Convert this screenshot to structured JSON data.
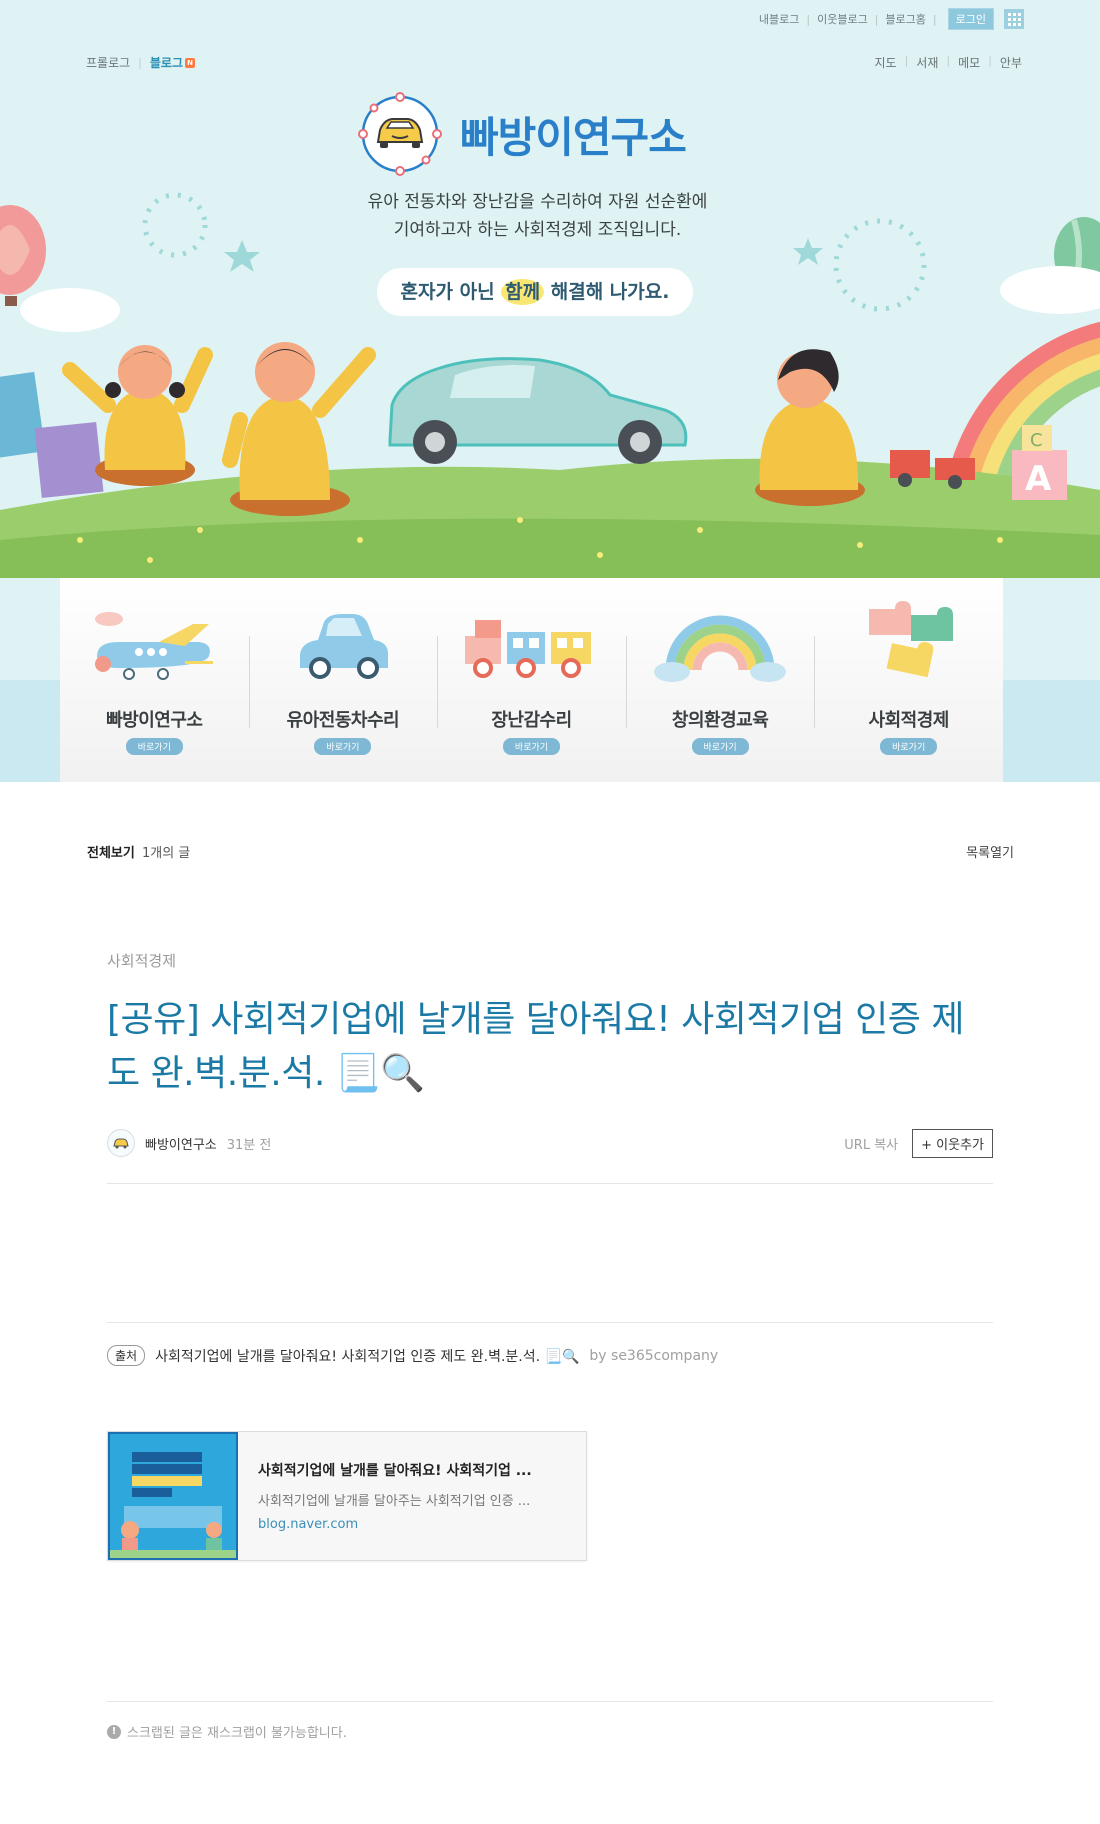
{
  "gnb": {
    "my_blog": "내블로그",
    "neighbor_blog": "이웃블로그",
    "blog_home": "블로그홈",
    "login": "로그인"
  },
  "lnb_left": {
    "prologue": "프롤로그",
    "blog": "블로그",
    "new_badge": "N"
  },
  "lnb_right": {
    "map": "지도",
    "library": "서재",
    "memo": "메모",
    "guestbook": "안부"
  },
  "header": {
    "blog_title": "빠방이연구소",
    "tagline_line1": "유아 전동차와 장난감을 수리하여 자원 선순환에",
    "tagline_line2": "기여하고자 하는 사회적경제 조직입니다.",
    "slogan_pre": "혼자가 아닌 ",
    "slogan_hl": "함께",
    "slogan_post": " 해결해 나가요."
  },
  "categories": [
    {
      "name": "빠방이연구소",
      "go": "바로가기",
      "icon": "airplane-icon"
    },
    {
      "name": "유아전동차수리",
      "go": "바로가기",
      "icon": "car-icon"
    },
    {
      "name": "장난감수리",
      "go": "바로가기",
      "icon": "toy-train-icon"
    },
    {
      "name": "창의환경교육",
      "go": "바로가기",
      "icon": "rainbow-icon"
    },
    {
      "name": "사회적경제",
      "go": "바로가기",
      "icon": "puzzle-icon"
    }
  ],
  "list": {
    "all": "전체보기",
    "count": "1개의 글",
    "open": "목록열기"
  },
  "post": {
    "category": "사회적경제",
    "title": "[공유] 사회적기업에 날개를 달아줘요! 사회적기업 인증 제도 완.벽.분.석. 📃🔍",
    "author": "빠방이연구소",
    "time": "31분 전",
    "url_copy": "URL 복사",
    "add_neighbor": "+ 이웃추가"
  },
  "source": {
    "tag": "출처",
    "text": "사회적기업에 날개를 달아줘요! 사회적기업 인증 제도 완.벽.분.석. 📃🔍",
    "by": "by se365company"
  },
  "card": {
    "title": "사회적기업에 날개를 달아줘요! 사회적기업 ...",
    "desc": "사회적기업에 날개를 달아주는 사회적기업 인증 ...",
    "url": "blog.naver.com"
  },
  "notice": "스크랩된 글은 재스크랩이 불가능합니다."
}
